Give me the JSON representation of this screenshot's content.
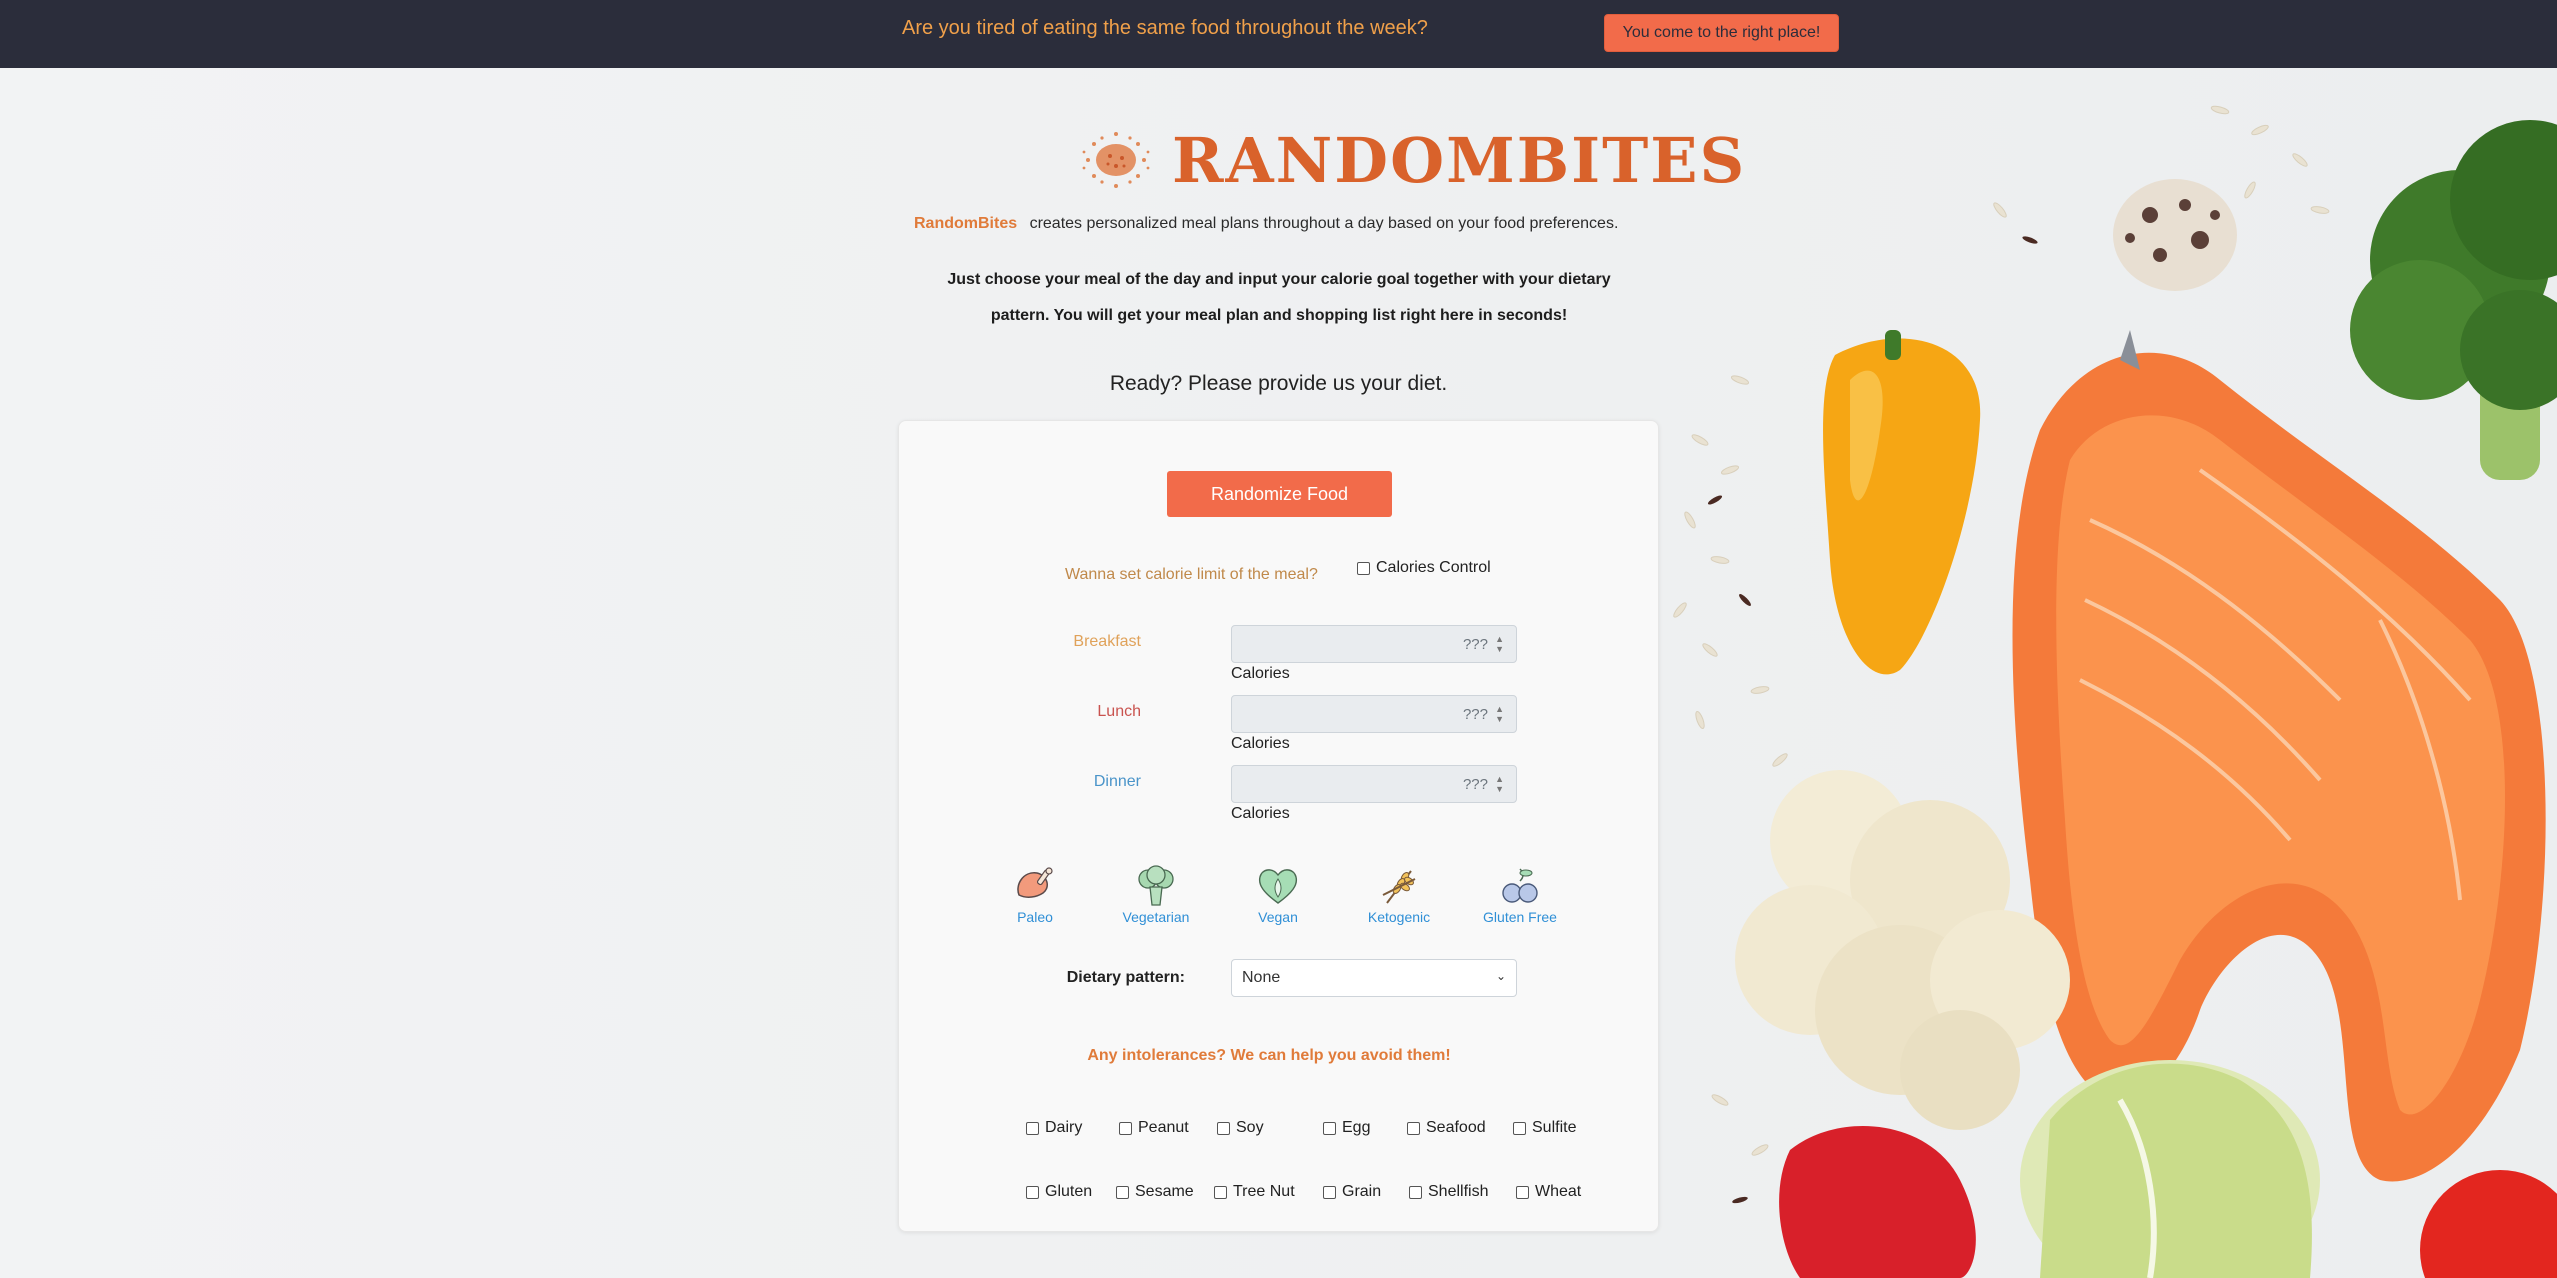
{
  "topbar": {
    "message": "Are you tired of eating the same food throughout the week?",
    "button_label": "You come to the right place!"
  },
  "logo": {
    "wordmark": "RANDOMBITES"
  },
  "intro": {
    "brand": "RandomBites",
    "text": "creates personalized meal plans throughout a day based on your food preferences."
  },
  "instructions": {
    "line1": "Just choose your meal of the day and input your calorie goal together with your dietary",
    "line2": "pattern. You will get your meal plan and shopping list right here in seconds!"
  },
  "ready": "Ready? Please provide us your diet.",
  "form": {
    "randomize_label": "Randomize Food",
    "calorie_question": "Wanna set calorie limit of the meal?",
    "calories_control_label": "Calories Control",
    "meals": [
      {
        "label": "Breakfast",
        "placeholder": "???",
        "unit": "Calories",
        "color": "#e0a25a"
      },
      {
        "label": "Lunch",
        "placeholder": "???",
        "unit": "Calories",
        "color": "#c9534f"
      },
      {
        "label": "Dinner",
        "placeholder": "???",
        "unit": "Calories",
        "color": "#4a94c9"
      }
    ],
    "diets": [
      {
        "label": "Paleo",
        "icon": "meat-icon"
      },
      {
        "label": "Vegetarian",
        "icon": "broccoli-icon"
      },
      {
        "label": "Vegan",
        "icon": "heart-leaf-icon"
      },
      {
        "label": "Ketogenic",
        "icon": "wheat-crossed-icon"
      },
      {
        "label": "Gluten Free",
        "icon": "olive-icon"
      }
    ],
    "dietary_pattern_label": "Dietary pattern:",
    "dietary_pattern_value": "None",
    "intolerance_title": "Any intolerances? We can help you avoid them!",
    "intolerances_row1": [
      "Dairy",
      "Peanut",
      "Soy",
      "Egg",
      "Seafood",
      "Sulfite"
    ],
    "intolerances_row2": [
      "Gluten",
      "Sesame",
      "Tree Nut",
      "Grain",
      "Shellfish",
      "Wheat"
    ]
  },
  "colors": {
    "topbar_bg": "#2b2d3b",
    "accent": "#f26b4a",
    "brand_orange": "#d9622b",
    "link_blue": "#2f8fd6"
  }
}
